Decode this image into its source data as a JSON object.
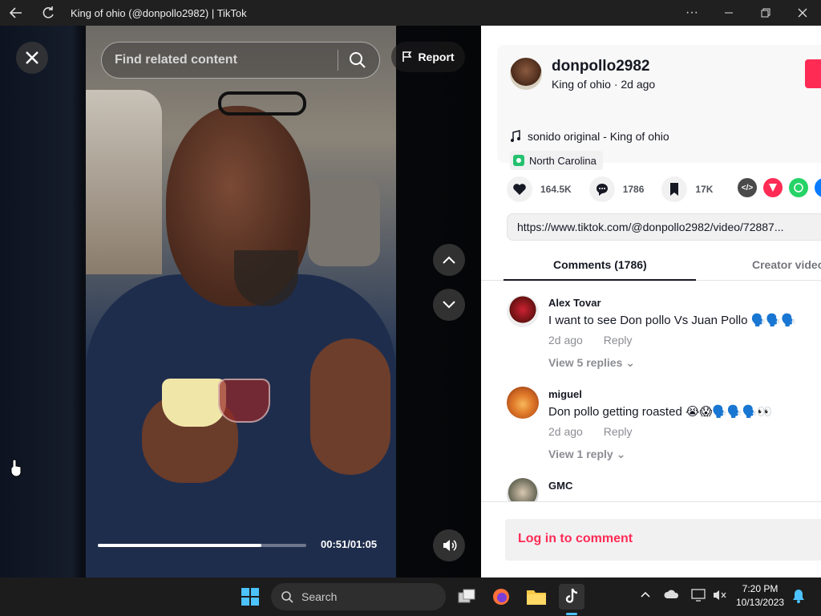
{
  "window": {
    "title": "King of ohio (@donpollo2982) | TikTok"
  },
  "video": {
    "search_placeholder": "Find related content",
    "report_label": "Report",
    "time_display": "00:51/01:05",
    "progress": 0.785
  },
  "author": {
    "username": "donpollo2982",
    "subline": "King of ohio · 2d ago",
    "music": "sonido original - King of ohio",
    "location": "North Carolina"
  },
  "stats": {
    "likes": "164.5K",
    "comments": "1786",
    "saves": "17K"
  },
  "share_url": "https://www.tiktok.com/@donpollo2982/video/72887...",
  "tabs": {
    "comments": "Comments (1786)",
    "creator": "Creator videos"
  },
  "comments": [
    {
      "name": "Alex Tovar",
      "text": "I want to see Don pollo Vs Juan Pollo 🗣️🗣️🗣️",
      "time": "2d ago",
      "reply": "Reply",
      "view_replies": "View 5 replies"
    },
    {
      "name": "miguel",
      "text": "Don pollo getting roasted 😭😱🗣️🗣️🗣️👀",
      "time": "2d ago",
      "reply": "Reply",
      "view_replies": "View 1 reply"
    },
    {
      "name": "GMC"
    }
  ],
  "login_label": "Log in to comment",
  "taskbar": {
    "search_label": "Search",
    "time": "7:20 PM",
    "date": "10/13/2023"
  },
  "colors": {
    "accent": "#fe2c55",
    "location_tag": "#25c16f"
  }
}
